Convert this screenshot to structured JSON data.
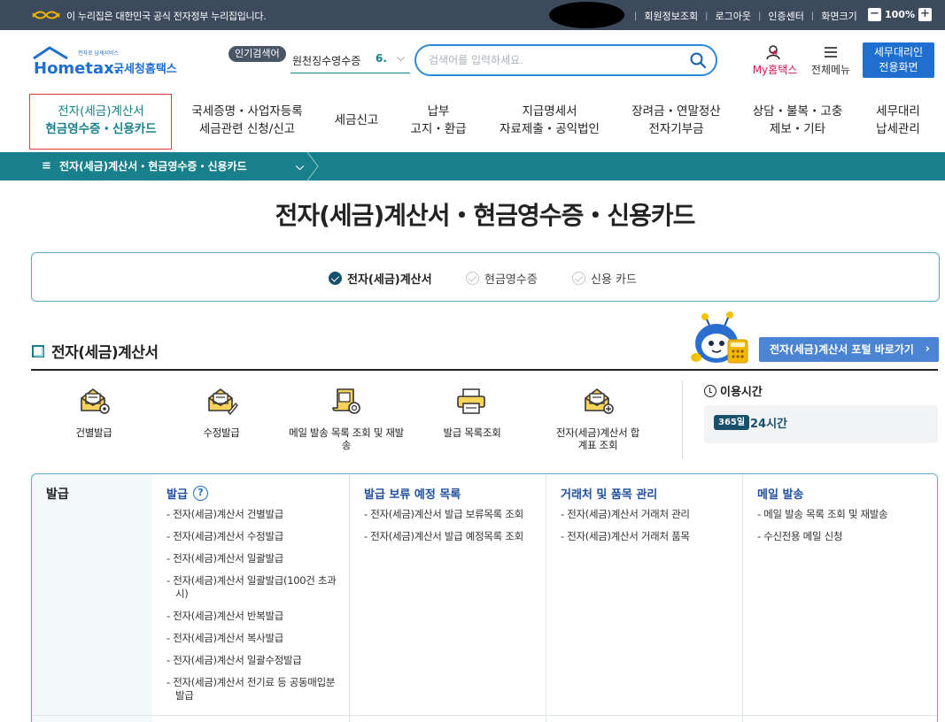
{
  "gov_bar": {
    "notice": "이 누리집은 대한민국 공식 전자정부 누리집입니다.",
    "links": [
      "회원정보조회",
      "로그아웃",
      "인증센터",
      "화면크기"
    ],
    "zoom_level": "100%",
    "zoom_minus": "−",
    "zoom_plus": "+"
  },
  "header": {
    "logo_text": "국세청홈택스",
    "logo_tagline": "전자로 납세서비스",
    "logo_mark": "Hometax.",
    "hot_label": "인기검색어",
    "hot_term": "원천징수영수증",
    "hot_rank": "6.",
    "search_placeholder": "검색어를 입력하세요.",
    "my_hometax": "My홈택스",
    "all_menu": "전체메뉴",
    "agent_line1": "세무대리인",
    "agent_line2": "전용화면"
  },
  "gnb": [
    {
      "line1": "전자(세금)계산서",
      "line2": "현금영수증・신용카드"
    },
    {
      "line1": "국세증명・사업자등록",
      "line2": "세금관련 신청/신고"
    },
    {
      "line1": "세금신고",
      "line2": ""
    },
    {
      "line1": "납부",
      "line2": "고지・환급"
    },
    {
      "line1": "지급명세서",
      "line2": "자료제출・공익법인"
    },
    {
      "line1": "장려금・연말정산",
      "line2": "전자기부금"
    },
    {
      "line1": "상담・불복・고충",
      "line2": "제보・기타"
    },
    {
      "line1": "세무대리",
      "line2": "납세관리"
    }
  ],
  "breadcrumb": {
    "label": "전자(세금)계산서・현금영수증・신용카드"
  },
  "page_title": "전자(세금)계산서・현금영수증・신용카드",
  "tabs": [
    {
      "label": "전자(세금)계산서",
      "selected": true
    },
    {
      "label": "현금영수증",
      "selected": false
    },
    {
      "label": "신용 카드",
      "selected": false
    }
  ],
  "section": {
    "title": "전자(세금)계산서",
    "portal_button": "전자(세금)계산서 포털 바로가기"
  },
  "quick_links": [
    {
      "label": "건별발급",
      "icon": "envelope-gear-icon"
    },
    {
      "label": "수정발급",
      "icon": "envelope-edit-icon"
    },
    {
      "label": "메일 발송 목록 조회 및 재발송",
      "icon": "scroll-search-icon"
    },
    {
      "label": "발급 목록조회",
      "icon": "printer-icon"
    },
    {
      "label": "전자(세금)계산서 합계표 조회",
      "icon": "envelope-plus-icon"
    }
  ],
  "usage": {
    "title": "이용시간",
    "badge": "365일",
    "hours": "24시간"
  },
  "menu": {
    "side_label": "발급",
    "columns": [
      {
        "title": "발급",
        "help": "?",
        "items": [
          "- 전자(세금)계산서 건별발급",
          "- 전자(세금)계산서 수정발급",
          "- 전자(세금)계산서 일괄발급",
          "- 전자(세금)계산서 일괄발급(100건 초과 시)",
          "- 전자(세금)계산서 반복발급",
          "- 전자(세금)계산서 복사발급",
          "- 전자(세금)계산서 일괄수정발급",
          "- 전자(세금)계산서 전기료 등 공동매입분 발급"
        ]
      },
      {
        "title": "발급 보류 예정 목록",
        "items": [
          "- 전자(세금)계산서 발급 보류목록 조회",
          "- 전자(세금)계산서 발급 예정목록 조회"
        ]
      },
      {
        "title": "거래처 및 품목 관리",
        "items": [
          "- 전자(세금)계산서 거래처 관리",
          "- 전자(세금)계산서 거래처 품목"
        ]
      },
      {
        "title": "메일 발송",
        "items": [
          "- 메일 발송 목록 조회 및 재발송",
          "- 수신전용 메일 신청"
        ]
      }
    ]
  },
  "colors": {
    "teal": "#18808a",
    "navy": "#17506b",
    "blue": "#1f6fd1",
    "highlight": "#e33333"
  }
}
